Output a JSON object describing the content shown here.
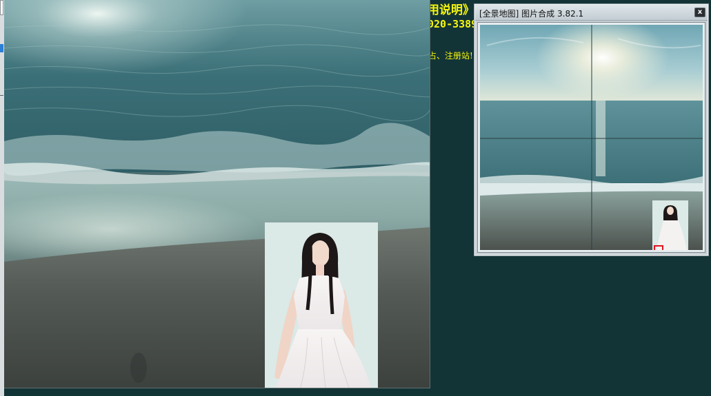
{
  "background_app": {
    "text_line1": "用说明》",
    "text_line2": "020-3389",
    "text_line3": "占、注册站!"
  },
  "canvas": {
    "scene": "beach photo with layered portrait image"
  },
  "overview_window": {
    "title": "[全景地图]  图片合成 3.82.1",
    "close_label": "x"
  },
  "colors": {
    "app_background": "#133436",
    "accent_text": "#f6f60c",
    "selection_marker": "#e0141e",
    "window_frame": "#c8d0d4"
  }
}
